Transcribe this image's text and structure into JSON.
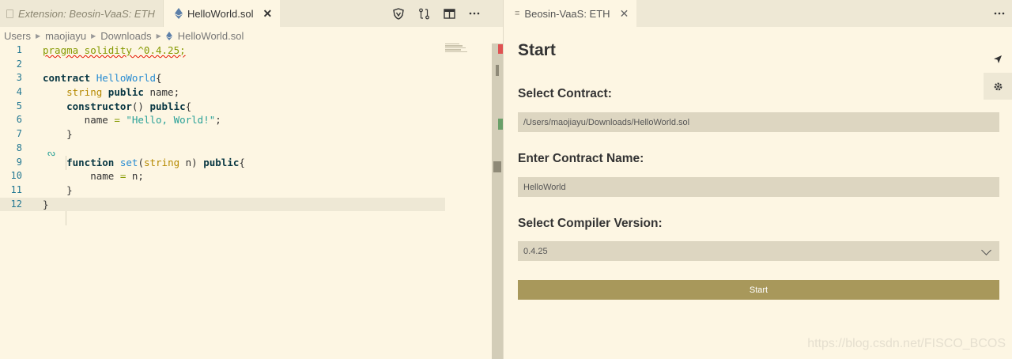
{
  "left_editor": {
    "tabs": [
      {
        "label": "Extension: Beosin-VaaS: ETH"
      },
      {
        "label": "HelloWorld.sol",
        "close": "✕"
      }
    ],
    "actions": [
      "shield-icon",
      "compare-icon",
      "split-editor-icon",
      "more-icon"
    ],
    "breadcrumb": [
      "Users",
      "maojiayu",
      "Downloads",
      "HelloWorld.sol"
    ],
    "line_numbers": [
      "1",
      "2",
      "3",
      "4",
      "5",
      "6",
      "7",
      "8",
      "9",
      "10",
      "11",
      "12"
    ]
  },
  "right_editor": {
    "tab": {
      "label": "Beosin-VaaS: ETH",
      "close": "✕"
    },
    "panel": {
      "title": "Start",
      "select_contract_label": "Select Contract:",
      "contract_path": "/Users/maojiayu/Downloads/HelloWorld.sol",
      "contract_name_label": "Enter Contract Name:",
      "contract_name": "HelloWorld",
      "compiler_label": "Select Compiler Version:",
      "compiler_version": "0.4.25",
      "start_button": "Start"
    },
    "side_actions": [
      "send-icon",
      "gear-icon"
    ]
  },
  "watermark": "https://blog.csdn.net/FISCO_BCOS",
  "colors": {
    "background": "#fdf6e3",
    "tabbar": "#eee8d5",
    "field": "#ddd6c1",
    "button": "#a8985b"
  }
}
